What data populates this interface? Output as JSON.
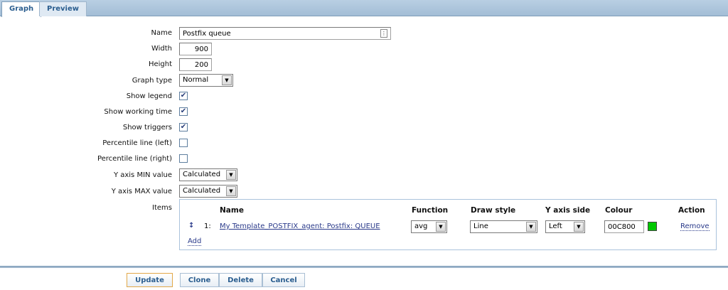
{
  "tabs": [
    {
      "label": "Graph",
      "active": true
    },
    {
      "label": "Preview",
      "active": false
    }
  ],
  "form": {
    "name": {
      "label": "Name",
      "value": "Postfix queue"
    },
    "width": {
      "label": "Width",
      "value": "900"
    },
    "height": {
      "label": "Height",
      "value": "200"
    },
    "graph_type": {
      "label": "Graph type",
      "value": "Normal"
    },
    "show_legend": {
      "label": "Show legend",
      "checked": true
    },
    "show_working_time": {
      "label": "Show working time",
      "checked": true
    },
    "show_triggers": {
      "label": "Show triggers",
      "checked": true
    },
    "percentile_left": {
      "label": "Percentile line (left)",
      "checked": false
    },
    "percentile_right": {
      "label": "Percentile line (right)",
      "checked": false
    },
    "y_min": {
      "label": "Y axis MIN value",
      "value": "Calculated"
    },
    "y_max": {
      "label": "Y axis MAX value",
      "value": "Calculated"
    },
    "items_label": "Items"
  },
  "items_table": {
    "headers": {
      "name": "Name",
      "function": "Function",
      "draw_style": "Draw style",
      "y_axis_side": "Y axis side",
      "colour": "Colour",
      "action": "Action"
    },
    "rows": [
      {
        "drag": "↕",
        "index": "1:",
        "name": "My Template_POSTFIX_agent: Postfix: QUEUE",
        "function": "avg",
        "draw_style": "Line",
        "y_axis_side": "Left",
        "colour": "00C800",
        "colour_hex": "#00c800",
        "action": "Remove"
      }
    ],
    "add_label": "Add"
  },
  "buttons": {
    "update": "Update",
    "clone": "Clone",
    "delete": "Delete",
    "cancel": "Cancel"
  }
}
